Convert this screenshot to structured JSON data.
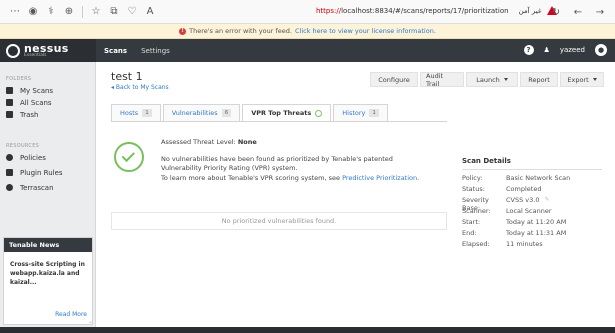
{
  "browser": {
    "url_scheme": "https://",
    "url_host_path": "localhost:8834/#/scans/reports/17/prioritization",
    "security_label": "غير آمن"
  },
  "banner": {
    "text": "There's an error with your feed.",
    "link": "Click here to view your license information."
  },
  "app": {
    "logo_name": "nessus",
    "logo_sub": "Essentials",
    "nav": [
      "Scans",
      "Settings"
    ],
    "user": "yazeed"
  },
  "sidebar": {
    "folders_label": "FOLDERS",
    "folders": [
      "My Scans",
      "All Scans",
      "Trash"
    ],
    "resources_label": "RESOURCES",
    "resources": [
      "Policies",
      "Plugin Rules",
      "Terrascan"
    ],
    "news_title": "Tenable News",
    "news_text": "Cross-site Scripting in webapp.kaiza.la and kaizal...",
    "news_more": "Read More"
  },
  "main": {
    "title": "test 1",
    "back": "◂ Back to My Scans",
    "actions": [
      {
        "label": "Configure",
        "dropdown": false
      },
      {
        "label": "Audit Trail",
        "dropdown": false
      },
      {
        "label": "Launch",
        "dropdown": true
      },
      {
        "label": "Report",
        "dropdown": false
      },
      {
        "label": "Export",
        "dropdown": true
      }
    ],
    "tabs": [
      {
        "label": "Hosts",
        "count": "1"
      },
      {
        "label": "Vulnerabilities",
        "count": "6"
      },
      {
        "label": "VPR Top Threats",
        "count": ""
      },
      {
        "label": "History",
        "count": "1"
      }
    ],
    "threat_label": "Assessed Threat Level:",
    "threat_value": "None",
    "message": "No vulnerabilities have been found as prioritized by Tenable's patented Vulnerability Priority Rating (VPR) system.",
    "learn_text": "To learn more about Tenable's VPR scoring system, see",
    "learn_link": "Predictive Prioritization.",
    "empty": "No prioritized vulnerabilities found."
  },
  "scan_details": {
    "title": "Scan Details",
    "rows": [
      {
        "key": "Policy:",
        "value": "Basic Network Scan"
      },
      {
        "key": "Status:",
        "value": "Completed"
      },
      {
        "key": "Severity Base:",
        "value": "CVSS v3.0"
      },
      {
        "key": "Scanner:",
        "value": "Local Scanner"
      },
      {
        "key": "Start:",
        "value": "Today at 11:20 AM"
      },
      {
        "key": "End:",
        "value": "Today at 11:31 AM"
      },
      {
        "key": "Elapsed:",
        "value": "11 minutes"
      }
    ]
  }
}
